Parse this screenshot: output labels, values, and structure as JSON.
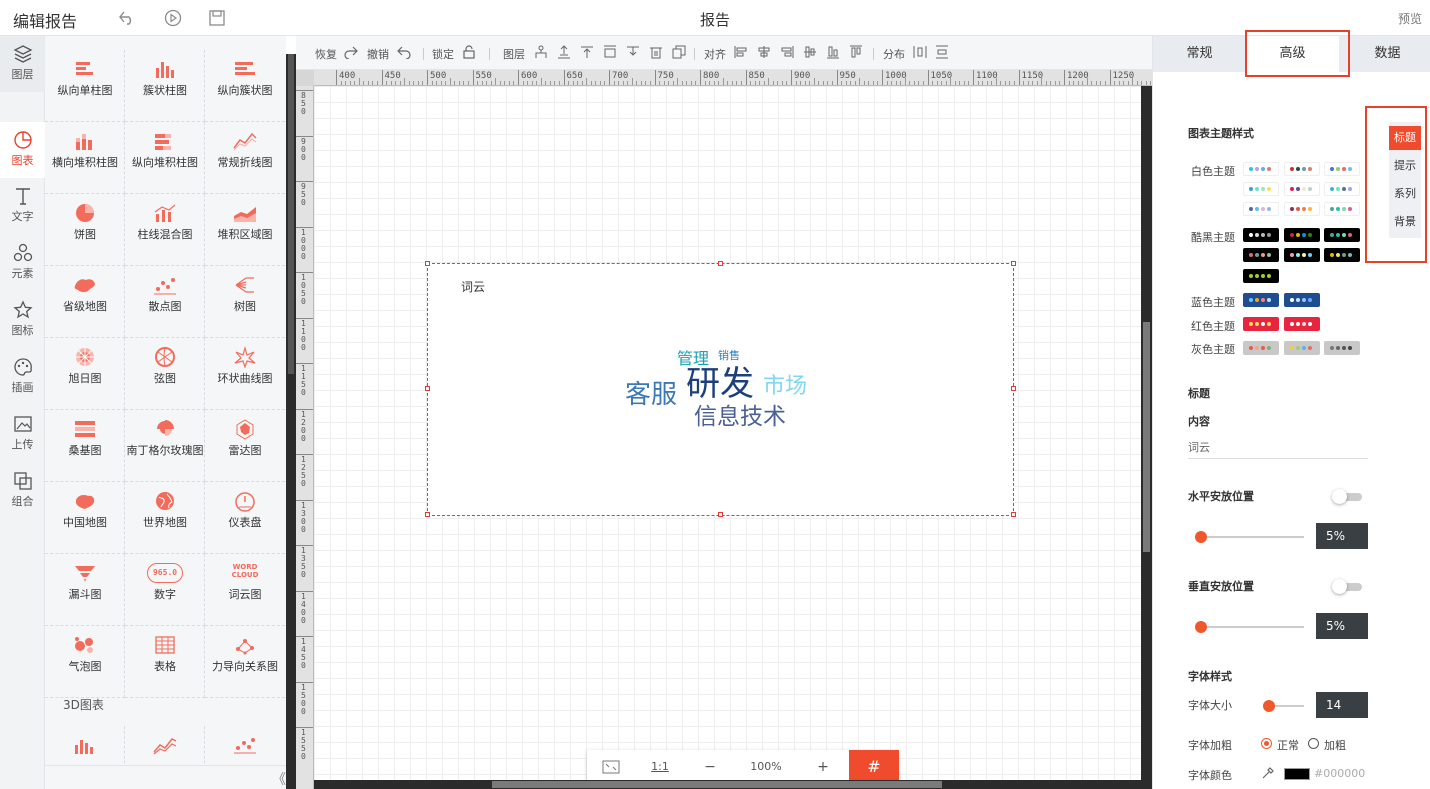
{
  "header": {
    "title": "编辑报告",
    "center_title": "报告",
    "preview": "预览"
  },
  "nav": {
    "items": [
      {
        "label": "图层",
        "icon": "layers-icon"
      },
      {
        "label": "图表",
        "icon": "chart-icon"
      },
      {
        "label": "文字",
        "icon": "text-icon"
      },
      {
        "label": "元素",
        "icon": "elements-icon"
      },
      {
        "label": "图标",
        "icon": "star-icon"
      },
      {
        "label": "插画",
        "icon": "palette-icon"
      },
      {
        "label": "上传",
        "icon": "upload-image-icon"
      },
      {
        "label": "组合",
        "icon": "group-icon"
      }
    ],
    "active_index": 1
  },
  "components": {
    "items": [
      "纵向单柱图",
      "簇状柱图",
      "纵向簇状图",
      "横向堆积柱图",
      "纵向堆积柱图",
      "常规折线图",
      "饼图",
      "柱线混合图",
      "堆积区域图",
      "省级地图",
      "散点图",
      "树图",
      "旭日图",
      "弦图",
      "环状曲线图",
      "桑基图",
      "南丁格尔玫瑰图",
      "雷达图",
      "中国地图",
      "世界地图",
      "仪表盘",
      "漏斗图",
      "数字",
      "词云图",
      "气泡图",
      "表格",
      "力导向关系图"
    ],
    "section_3d": "3D图表",
    "number_icon_text": "965.0",
    "word_icon_text": [
      "WORD",
      "CLOUD"
    ]
  },
  "toolbar": {
    "redo": "恢复",
    "undo": "撤销",
    "lock": "锁定",
    "layer": "图层",
    "align": "对齐",
    "distribute": "分布"
  },
  "ruler": {
    "top": [
      "400",
      "450",
      "500",
      "550",
      "600",
      "650",
      "700",
      "750",
      "800",
      "850",
      "900",
      "950",
      "1000",
      "1050",
      "1100",
      "1150",
      "1200",
      "1250"
    ],
    "left": [
      "850",
      "900",
      "950",
      "1000",
      "1050",
      "1100",
      "1150",
      "1200",
      "1250",
      "1300",
      "1350",
      "1400",
      "1450",
      "1500",
      "1550"
    ]
  },
  "widget": {
    "title": "词云",
    "words": [
      {
        "text": "研发",
        "color": "#1d3f7a"
      },
      {
        "text": "客服",
        "color": "#3a78b8"
      },
      {
        "text": "信息技术",
        "color": "#4a5f94"
      },
      {
        "text": "市场",
        "color": "#7fd8ef"
      },
      {
        "text": "管理",
        "color": "#1aa0b5"
      },
      {
        "text": "销售",
        "color": "#2a7fc0"
      }
    ]
  },
  "zoom": {
    "ratio": "1:1",
    "minus": "−",
    "value": "100%",
    "plus": "+"
  },
  "right_panel": {
    "tabs": [
      "常规",
      "高级",
      "数据"
    ],
    "active_tab": 1,
    "section_title": "图表主题样式",
    "themes": [
      {
        "label": "白色主题"
      },
      {
        "label": "酷黑主题"
      },
      {
        "label": "蓝色主题"
      },
      {
        "label": "红色主题"
      },
      {
        "label": "灰色主题"
      }
    ],
    "subnav": [
      "标题",
      "提示",
      "系列",
      "背景"
    ],
    "title_label": "标题",
    "content_label": "内容",
    "content_value": "词云",
    "horizontal_label": "水平安放位置",
    "horizontal_value": "5%",
    "vertical_label": "垂直安放位置",
    "vertical_value": "5%",
    "font_style_label": "字体样式",
    "font_size_label": "字体大小",
    "font_size_value": "14",
    "font_weight_label": "字体加粗",
    "weight_normal": "正常",
    "weight_bold": "加粗",
    "font_color_label": "字体颜色",
    "font_color_value": "#000000"
  },
  "colors": {
    "accent": "#e9402a",
    "panel_bg": "#f5f6f8"
  }
}
